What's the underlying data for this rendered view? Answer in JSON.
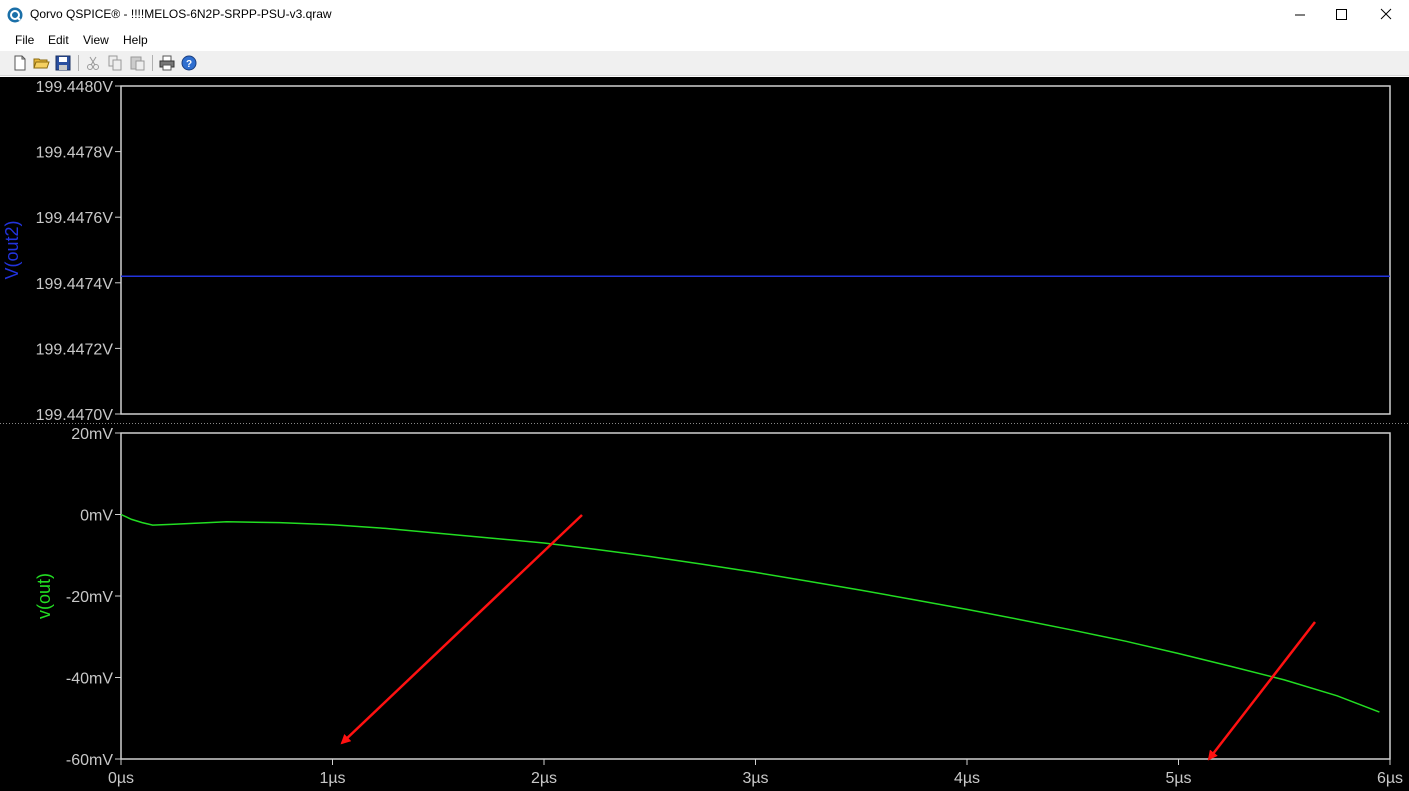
{
  "window": {
    "title": "Qorvo QSPICE® - !!!!MELOS-6N2P-SRPP-PSU-v3.qraw",
    "icon": "qspice-logo-icon",
    "controls": [
      "minimize-icon",
      "maximize-icon",
      "close-icon"
    ]
  },
  "menu": {
    "file": "File",
    "edit": "Edit",
    "view": "View",
    "help": "Help"
  },
  "toolbar": [
    "new-file-icon",
    "open-folder-icon",
    "save-icon",
    "cut-icon",
    "copy-icon",
    "paste-icon",
    "print-icon",
    "help-icon"
  ],
  "colors": {
    "background": "#000000",
    "frame": "#d0d0d0",
    "trace_top": "#2233dd",
    "trace_bottom": "#22dd22",
    "arrows": "#ff1111"
  },
  "chart_data": [
    {
      "type": "line",
      "ylabel": "V(out2)",
      "yticks": [
        "199.4480V",
        "199.4478V",
        "199.4476V",
        "199.4474V",
        "199.4472V",
        "199.4470V"
      ],
      "ylim": [
        199.447,
        199.448
      ],
      "xlim": [
        0,
        6
      ],
      "series": [
        {
          "color": "#2233dd",
          "x": [
            0,
            6
          ],
          "y": [
            199.44742,
            199.44742
          ]
        }
      ]
    },
    {
      "type": "line",
      "ylabel": "v(out)",
      "yticks": [
        "20mV",
        "0mV",
        "-20mV",
        "-40mV",
        "-60mV"
      ],
      "xticks": [
        "0µs",
        "1µs",
        "2µs",
        "3µs",
        "4µs",
        "5µs",
        "6µs"
      ],
      "ylim": [
        -60,
        20
      ],
      "xlim": [
        0,
        6
      ],
      "series": [
        {
          "color": "#22dd22",
          "x": [
            0,
            0.05,
            0.1,
            0.15,
            0.25,
            0.5,
            0.75,
            1.0,
            1.25,
            1.5,
            1.75,
            2.0,
            2.25,
            2.5,
            2.75,
            3.0,
            3.25,
            3.5,
            3.75,
            4.0,
            4.25,
            4.5,
            4.75,
            5.0,
            5.25,
            5.5,
            5.75,
            5.95
          ],
          "y": [
            0,
            -1.2,
            -2.0,
            -2.6,
            -2.4,
            -1.8,
            -2.0,
            -2.5,
            -3.4,
            -4.6,
            -5.8,
            -7.0,
            -8.6,
            -10.3,
            -12.2,
            -14.2,
            -16.4,
            -18.6,
            -20.9,
            -23.3,
            -25.8,
            -28.4,
            -31.1,
            -34.1,
            -37.3,
            -40.6,
            -44.5,
            -48.5
          ]
        }
      ]
    }
  ]
}
